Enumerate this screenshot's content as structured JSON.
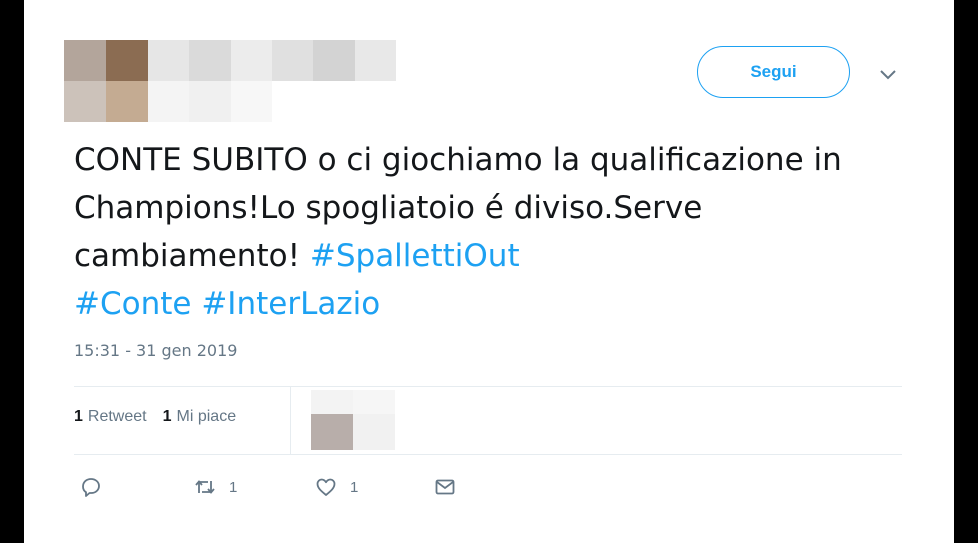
{
  "tweet": {
    "follow_label": "Segui",
    "text_plain": "CONTE SUBITO o ci giochiamo la qualificazione in Champions!Lo spogliatoio é diviso.Serve cambiamento! ",
    "hashtags": [
      "#SpallettiOut",
      "#Conte",
      "#InterLazio"
    ],
    "timestamp": "15:31 - 31 gen 2019"
  },
  "stats": {
    "retweets_count": "1",
    "retweets_label": "Retweet",
    "likes_count": "1",
    "likes_label": "Mi piace"
  },
  "actions": {
    "reply_icon": "reply-icon",
    "retweet_icon": "retweet-icon",
    "retweet_count": "1",
    "like_icon": "heart-icon",
    "like_count": "1",
    "dm_icon": "envelope-icon"
  },
  "colors": {
    "accent": "#1da1f2",
    "text": "#14171a",
    "muted": "#657786",
    "divider": "#e6ecf0"
  }
}
